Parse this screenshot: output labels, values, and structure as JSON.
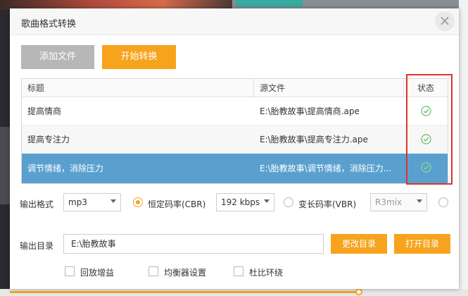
{
  "dialog": {
    "title": "歌曲格式转换",
    "close_glyph": "×"
  },
  "toolbar": {
    "add_label": "添加文件",
    "start_label": "开始转换"
  },
  "table": {
    "headers": [
      "标题",
      "源文件",
      "状态"
    ],
    "rows": [
      {
        "title": "提高情商",
        "source": "E:\\胎教故事\\提高情商.ape",
        "status": "done"
      },
      {
        "title": "提高专注力",
        "source": "E:\\胎教故事\\提高专注力.ape",
        "status": "done"
      },
      {
        "title": "调节情绪，消除压力",
        "source": "E:\\胎教故事\\调节情绪，消除压力...",
        "status": "done",
        "selected": true
      }
    ],
    "status_color": "#5cb85c",
    "selected_row_color": "#5aa0cf",
    "highlight_color": "#e0322c"
  },
  "form": {
    "format_label": "输出格式",
    "format_value": "mp3",
    "cbr_label": "恒定码率(CBR)",
    "cbr_value": "192 kbps",
    "vbr_label": "变长码率(VBR)",
    "vbr_value": "R3mix",
    "dir_label": "输出目录",
    "dir_value": "E:\\胎教故事",
    "change_dir_label": "更改目录",
    "open_dir_label": "打开目录",
    "options": [
      "回放增益",
      "均衡器设置",
      "杜比环绕"
    ]
  },
  "accent_color": "#f7a31c"
}
